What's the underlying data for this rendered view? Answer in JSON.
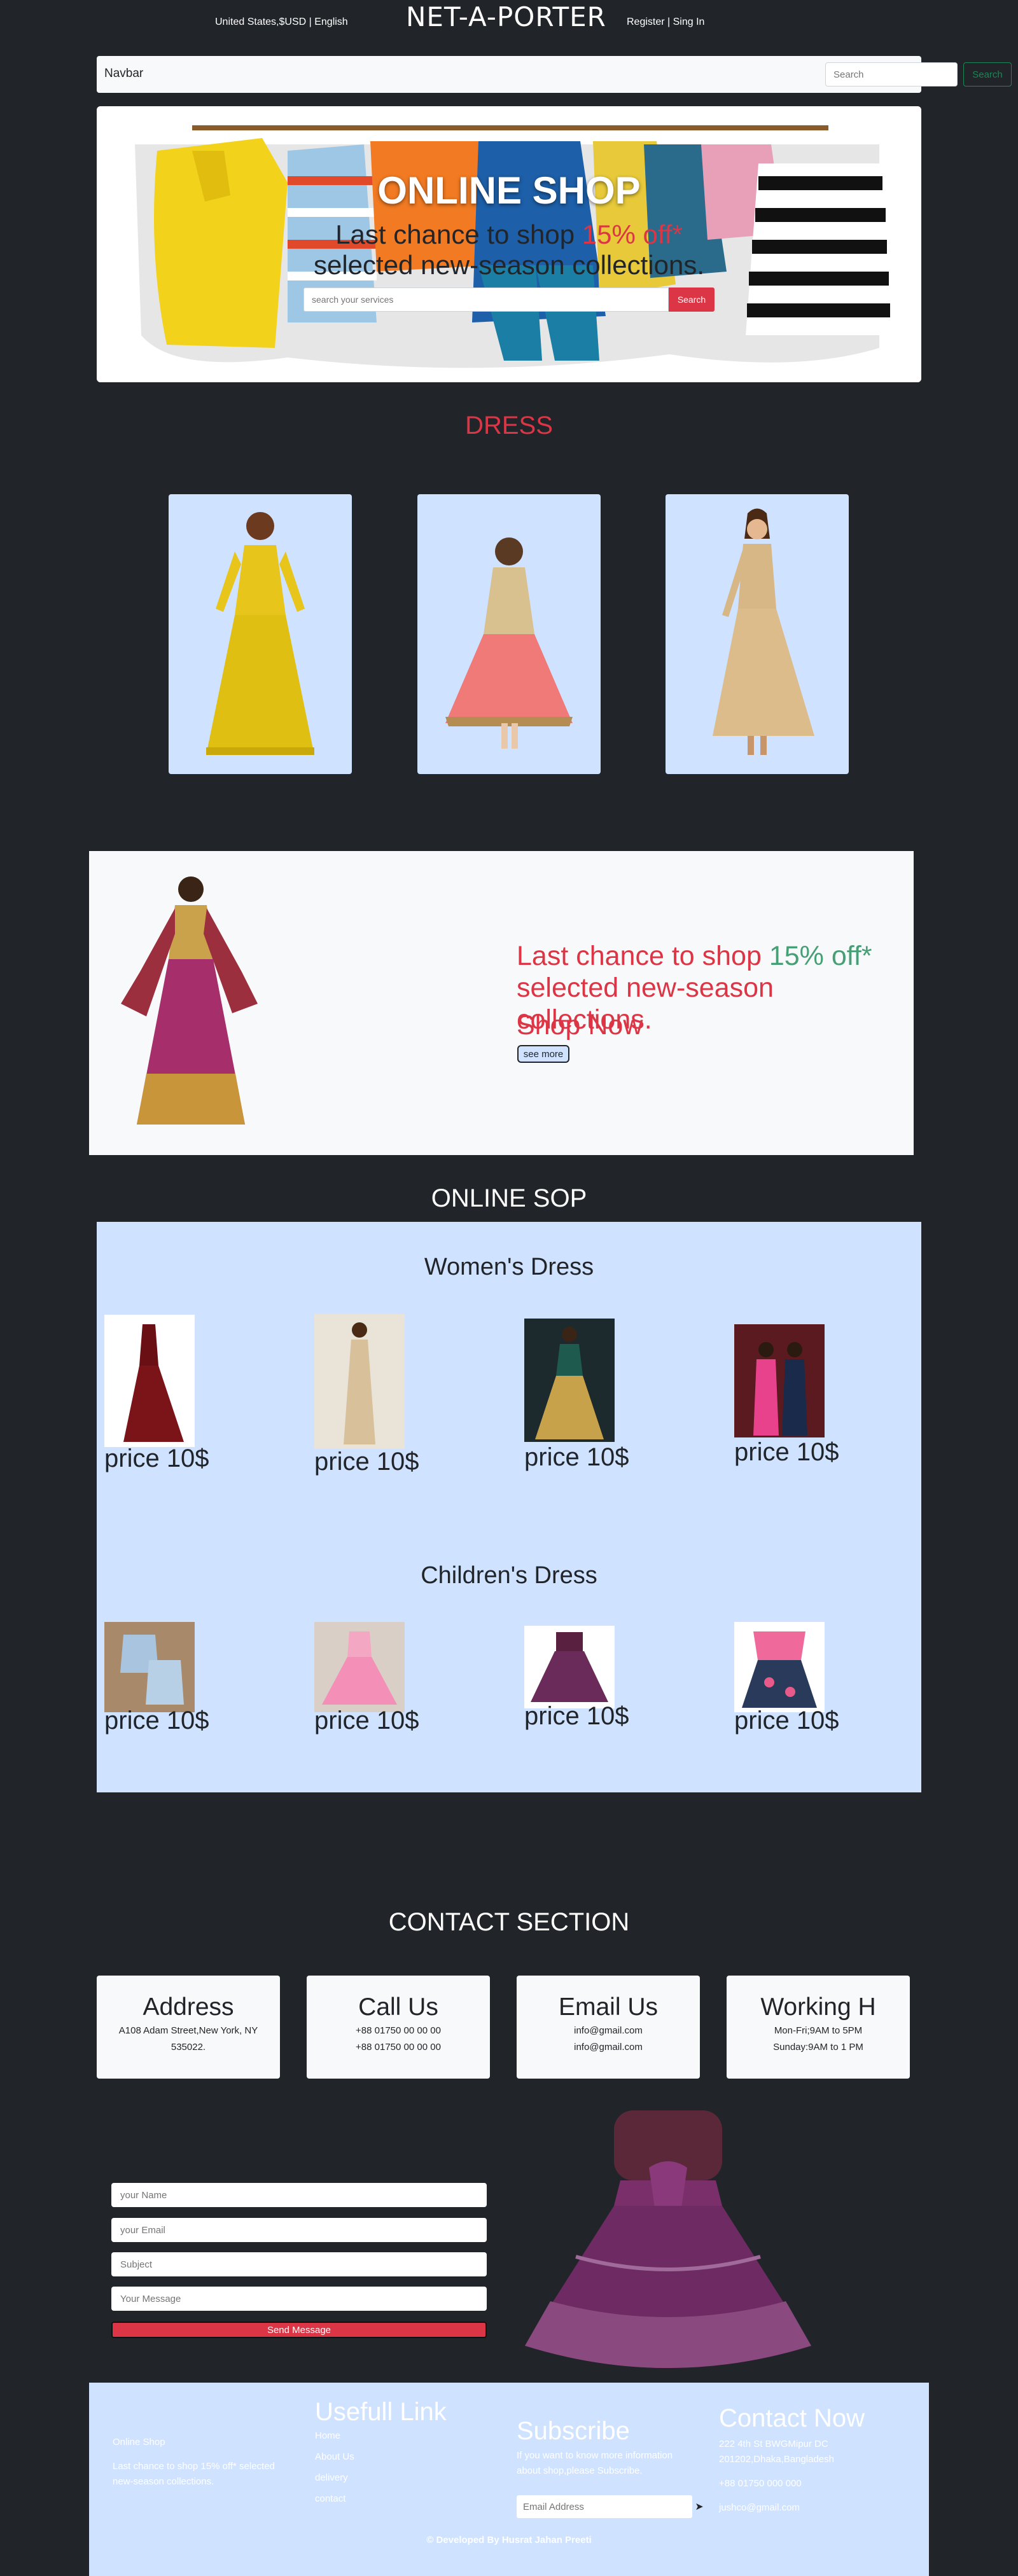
{
  "topbar": {
    "locale": "United States,$USD | English",
    "brand": "NET-A-PORTER",
    "auth": "Register | Sing In"
  },
  "navbar": {
    "brand": "Navbar",
    "search_placeholder": "Search",
    "search_button": "Search"
  },
  "hero": {
    "title": "ONLINE SHOP",
    "line1_prefix": "Last chance to shop ",
    "line1_highlight": "15% off*",
    "line2": "selected new-season collections.",
    "search_placeholder": "search your services",
    "search_button": "Search"
  },
  "dress_section": {
    "title": "DRESS"
  },
  "promo": {
    "line1_prefix": "Last chance to shop ",
    "line1_highlight": "15% off*",
    "line2": "selected new-season collections.",
    "shop_now": "Shop Now",
    "button": "see more"
  },
  "shop": {
    "title": "ONLINE SOP",
    "women_title": "Women's Dress",
    "children_title": "Children's Dress",
    "women_prices": [
      "price 10$",
      "price 10$",
      "price 10$",
      "price 10$"
    ],
    "children_prices": [
      "price 10$",
      "price 10$",
      "price 10$",
      "price 10$"
    ]
  },
  "contact": {
    "title": "CONTACT SECTION",
    "cards": [
      {
        "heading": "Address",
        "line1": "A108 Adam Street,New York, NY",
        "line2": "535022."
      },
      {
        "heading": "Call Us",
        "line1": "+88 01750 00 00 00",
        "line2": "+88 01750 00 00 00"
      },
      {
        "heading": "Email Us",
        "line1": "info@gmail.com",
        "line2": "info@gmail.com"
      },
      {
        "heading": "Working H",
        "line1": "Mon-Fri;9AM to 5PM",
        "line2": "Sunday:9AM to 1 PM"
      }
    ]
  },
  "form": {
    "name_placeholder": "your Name",
    "email_placeholder": "your Email",
    "subject_placeholder": "Subject",
    "message_placeholder": "Your Message",
    "button": "Send Message"
  },
  "footer": {
    "brand": "Online Shop",
    "tagline1": "Last chance to shop 15% off* selected",
    "tagline2": "new-season collections.",
    "links_title": "Usefull Link",
    "links": [
      "Home",
      "About Us",
      "delivery",
      "contact"
    ],
    "subscribe_title": "Subscribe",
    "subscribe_text1": "If you want to know more information",
    "subscribe_text2": "about shop,please Subscribe.",
    "email_placeholder": "Email Address",
    "contact_title": "Contact Now",
    "contact_addr1": "222 4th St BWGMipur DC",
    "contact_addr2": "201202,Dhaka,Bangladesh",
    "contact_phone": "+88 01750 000 000",
    "contact_email": "jushco@gmail.com",
    "copyright": "© Developed By Husrat Jahan Preeti"
  },
  "colors": {
    "background": "#212529",
    "light": "#f8f9fa",
    "card_blue": "#cfe2ff",
    "accent_red": "#dc3545",
    "accent_green": "#479f76"
  }
}
